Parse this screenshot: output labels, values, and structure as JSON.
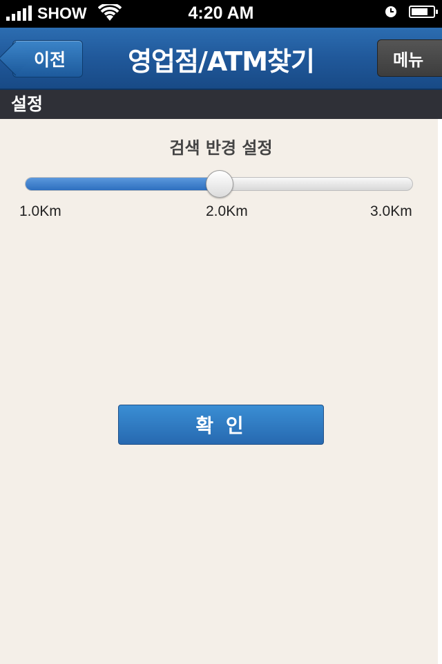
{
  "status_bar": {
    "carrier": "SHOW",
    "time": "4:20 AM",
    "icons": [
      "signal-icon",
      "wifi-icon",
      "clock-icon",
      "battery-icon"
    ]
  },
  "navbar": {
    "back_label": "이전",
    "title": "영업점/ATM찾기",
    "menu_label": "메뉴"
  },
  "section": {
    "title": "설정"
  },
  "radius": {
    "title": "검색 반경 설정",
    "min_label": "1.0Km",
    "mid_label": "2.0Km",
    "max_label": "3.0Km",
    "value_fraction": 0.5
  },
  "confirm": {
    "label": "확 인"
  },
  "colors": {
    "navbar": "#20589a",
    "section_header": "#2f3037",
    "background": "#f4efe8",
    "accent": "#2d6fbf"
  }
}
